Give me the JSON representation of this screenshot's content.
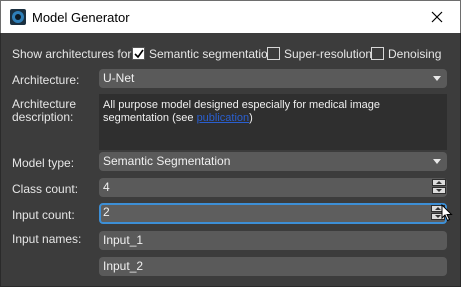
{
  "window": {
    "title": "Model Generator",
    "icon": "app-logo-icon"
  },
  "filters": {
    "label": "Show architectures for:",
    "options": [
      {
        "label": "Semantic segmentation",
        "checked": true
      },
      {
        "label": "Super-resolution",
        "checked": false
      },
      {
        "label": "Denoising",
        "checked": false
      }
    ]
  },
  "architecture": {
    "label": "Architecture:",
    "value": "U-Net"
  },
  "description": {
    "label_line1": "Architecture",
    "label_line2": "description:",
    "text_before": "All purpose model designed especially for medical image segmentation (see ",
    "link_text": "publication",
    "text_after": ")"
  },
  "model_type": {
    "label": "Model type:",
    "value": "Semantic Segmentation"
  },
  "class_count": {
    "label": "Class count:",
    "value": "4"
  },
  "input_count": {
    "label": "Input count:",
    "value": "2"
  },
  "input_names": {
    "label": "Input names:",
    "values": [
      "Input_1",
      "Input_2"
    ]
  },
  "colors": {
    "background": "#3c3c3c",
    "field": "#5a5a5a",
    "focus_border": "#3d8fd6",
    "link": "#2a5fd0"
  }
}
